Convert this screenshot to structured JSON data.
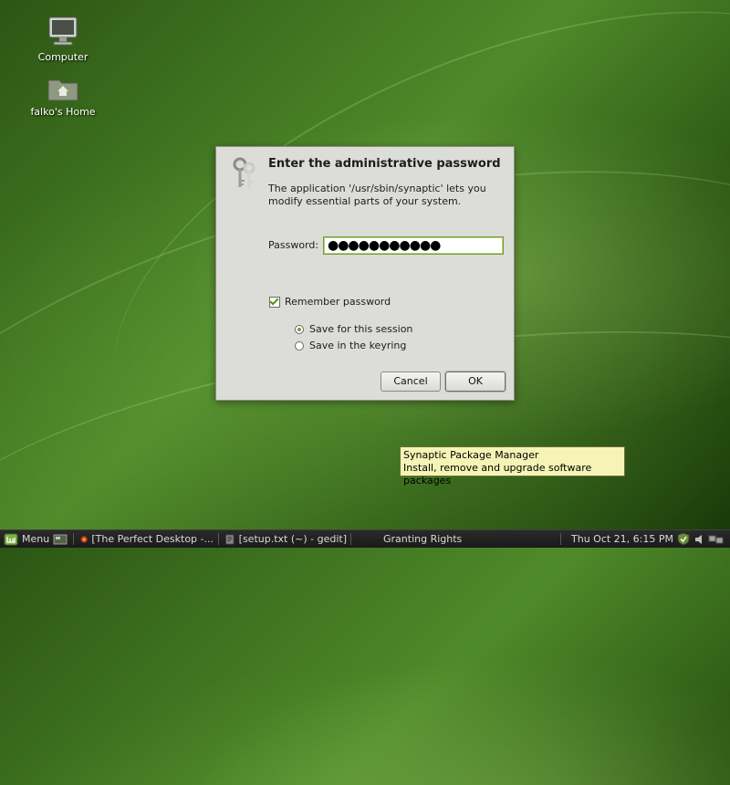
{
  "desktop": {
    "icons": [
      {
        "label": "Computer",
        "icon": "computer-icon"
      },
      {
        "label": "falko's Home",
        "icon": "home-folder-icon"
      }
    ]
  },
  "dialog": {
    "icon": "keys-icon",
    "title": "Enter the administrative password",
    "description": "The application '/usr/sbin/synaptic' lets you modify essential parts of your system.",
    "password_label": "Password:",
    "password_value": "●●●●●●●●●●●",
    "remember_label": "Remember password",
    "remember_checked": true,
    "options": [
      {
        "label": "Save for this session",
        "selected": true
      },
      {
        "label": "Save in the keyring",
        "selected": false
      }
    ],
    "cancel_label": "Cancel",
    "ok_label": "OK"
  },
  "tooltip": {
    "line1": "Synaptic Package Manager",
    "line2": "Install, remove and upgrade software packages"
  },
  "taskbar": {
    "menu_label": "Menu",
    "tasks": [
      {
        "label": "[The Perfect Desktop -...",
        "icon": "browser-icon"
      },
      {
        "label": "[setup.txt (~) - gedit]",
        "icon": "text-editor-icon"
      },
      {
        "label": "Granting Rights",
        "icon": "none"
      }
    ],
    "clock": "Thu Oct 21,  6:15 PM",
    "tray_icons": [
      "shield-icon",
      "volume-icon",
      "network-icon"
    ]
  },
  "colors": {
    "accent": "#6ea42c",
    "dialog_bg": "#dcdcd8",
    "tooltip_bg": "#f5f3b5",
    "taskbar_bg": "#1f1f1f"
  }
}
